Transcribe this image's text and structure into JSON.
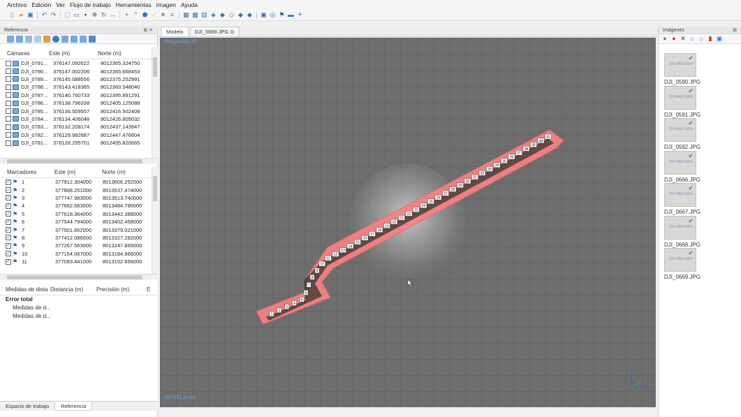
{
  "menu": [
    "Archivo",
    "Edición",
    "Ver",
    "Flujo de trabajo",
    "Herramientas",
    "Imagen",
    "Ayuda"
  ],
  "reference_panel": {
    "title": "Referencia",
    "cameras": {
      "headers": [
        "Cámaras",
        "Este (m)",
        "Norte (m)"
      ],
      "rows": [
        [
          "DJI_0791...",
          "376147.092622",
          "8012365.324750"
        ],
        [
          "DJI_0790...",
          "376147.002206",
          "8012365.668453"
        ],
        [
          "DJI_0789...",
          "376145.088556",
          "8012375.252991"
        ],
        [
          "DJI_0788...",
          "376143.418365",
          "8012383.548040"
        ],
        [
          "DJI_0787...",
          "376140.760733",
          "8012395.891291"
        ],
        [
          "DJI_0786...",
          "376138.796338",
          "8012405.125088"
        ],
        [
          "DJI_0785...",
          "376136.509557",
          "8012416.502408"
        ],
        [
          "DJI_0784...",
          "376134.406048",
          "8012426.805032"
        ],
        [
          "DJI_0783...",
          "376132.208174",
          "8012437.143947"
        ],
        [
          "DJI_0782...",
          "376129.992687",
          "8012447.476604"
        ],
        [
          "DJI_0781...",
          "376128.295701",
          "8012455.820665"
        ]
      ]
    },
    "markers": {
      "headers": [
        "Marcadores",
        "Este (m)",
        "Norte (m)"
      ],
      "rows": [
        [
          "1",
          "377912.304000",
          "8013606.252000"
        ],
        [
          "2",
          "377808.251000",
          "8013537.474000"
        ],
        [
          "3",
          "377747.983000",
          "8013513.740000"
        ],
        [
          "4",
          "377692.663000",
          "8013484.790000"
        ],
        [
          "5",
          "377618.364000",
          "8013442.388000"
        ],
        [
          "6",
          "377544.794000",
          "8013402.458000"
        ],
        [
          "7",
          "377501.652000",
          "8013379.021000"
        ],
        [
          "8",
          "377412.086000",
          "8013327.282000"
        ],
        [
          "9",
          "377267.563000",
          "8013247.865000"
        ],
        [
          "10",
          "377154.067000",
          "8013184.966000"
        ],
        [
          "11",
          "377093.441000",
          "8013152.656000"
        ]
      ]
    },
    "distances": {
      "headers": [
        "Medidas de dista",
        "Distancia (m)",
        "Precisión (m)",
        "E"
      ],
      "total_label": "Error total",
      "items": [
        "Medidas de d...",
        "Medidas de d..."
      ]
    },
    "bottom_tabs": [
      "Espacio de trabajo",
      "Referencia"
    ]
  },
  "model": {
    "tabs": [
      "Modelo",
      "DJI_0669.JPG"
    ],
    "perspective_label": "Perspective 30°",
    "scale_label": "257.531 acres"
  },
  "images_panel": {
    "title": "Imágenes",
    "no_mask_label": "SIN MÁSCARA",
    "thumbs": [
      "DJI_0590.JPG",
      "DJI_0591.JPG",
      "DJI_0592.JPG",
      "DJI_0666.JPG",
      "DJI_0667.JPG",
      "DJI_0668.JPG",
      "DJI_0669.JPG"
    ]
  },
  "viewport_markers": [
    "1",
    "2",
    "3",
    "4",
    "5",
    "6",
    "7",
    "8",
    "9",
    "10",
    "11",
    "12",
    "13",
    "14",
    "15",
    "16",
    "17",
    "18",
    "19",
    "20",
    "21",
    "22",
    "23",
    "24",
    "25",
    "26",
    "27",
    "28",
    "29",
    "30",
    "31",
    "32",
    "33",
    "34",
    "35",
    "36",
    "37",
    "38",
    "39",
    "40",
    "41"
  ]
}
